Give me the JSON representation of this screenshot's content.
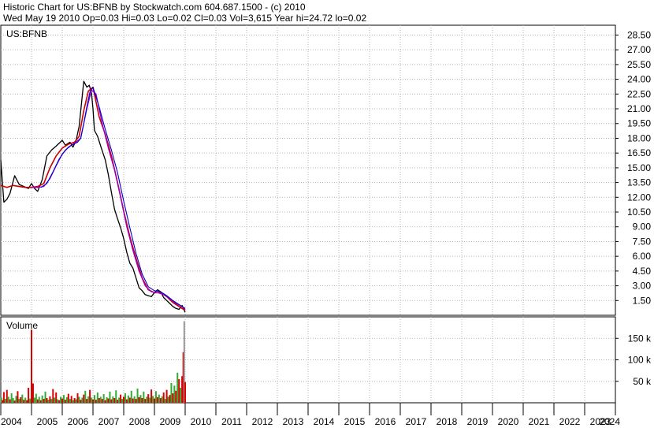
{
  "header": {
    "line1": "Historic Chart for US:BFNB by Stockwatch.com 604.687.1500 - (c) 2010",
    "line2": "Wed May 19 2010   Op=0.03  Hi=0.03  Lo=0.02  Cl=0.03  Vol=3,615  Year hi=24.72  lo=0.02"
  },
  "price_panel": {
    "symbol_label": "US:BFNB"
  },
  "volume_panel": {
    "label": "Volume"
  },
  "colors": {
    "up_volume": "#33aa33",
    "down_volume": "#dd0000",
    "spike_volume": "#999999",
    "ma_short": "#cc0000",
    "ma_mid": "#9900cc",
    "ma_long": "#0000cc",
    "price_bar": "#000000",
    "grid": "#b4b4b4"
  },
  "chart_data": [
    {
      "type": "line",
      "panel": "price",
      "ylim": [
        0,
        29.5
      ],
      "y_ticks": [
        1.5,
        3.0,
        4.5,
        6.0,
        7.5,
        9.0,
        10.5,
        12.0,
        13.5,
        15.0,
        16.5,
        18.0,
        19.5,
        21.0,
        22.5,
        24.0,
        25.5,
        27.0,
        28.5
      ],
      "y_tick_labels": [
        "1.50",
        "3.00",
        "4.50",
        "6.00",
        "7.50",
        "9.00",
        "10.50",
        "12.00",
        "13.50",
        "15.00",
        "16.50",
        "18.00",
        "19.50",
        "21.00",
        "22.50",
        "24.00",
        "25.50",
        "27.00",
        "28.50"
      ],
      "x_ticks": [
        "2004",
        "2005",
        "2006",
        "2007",
        "2008",
        "2009",
        "2010",
        "2011",
        "2012",
        "2013",
        "2014",
        "2015",
        "2016",
        "2017",
        "2018",
        "2019",
        "2020",
        "2021",
        "2022",
        "2023",
        "2024"
      ],
      "grid": true,
      "series": [
        {
          "x": [
            2004.0,
            2004.1,
            2004.2,
            2004.3,
            2004.45,
            2004.6,
            2004.75,
            2004.9,
            2005.0,
            2005.1,
            2005.2,
            2005.35,
            2005.5,
            2005.65,
            2005.8,
            2006.0,
            2006.1,
            2006.25,
            2006.35,
            2006.45,
            2006.55,
            2006.7,
            2006.8,
            2006.88,
            2006.95,
            2007.0,
            2007.05,
            2007.15,
            2007.25,
            2007.4,
            2007.5,
            2007.6,
            2007.7,
            2007.8,
            2007.9,
            2008.0,
            2008.1,
            2008.2,
            2008.3,
            2008.4,
            2008.5,
            2008.6,
            2008.7,
            2008.8,
            2008.9,
            2009.0,
            2009.1,
            2009.2,
            2009.3,
            2009.4,
            2009.5,
            2009.6,
            2009.7,
            2009.8,
            2009.9,
            2010.0
          ],
          "values": [
            15.8,
            11.5,
            11.8,
            12.4,
            14.2,
            13.3,
            13.1,
            12.9,
            13.4,
            12.9,
            12.6,
            13.8,
            16.2,
            16.8,
            17.2,
            17.8,
            17.3,
            17.6,
            17.1,
            17.8,
            19.2,
            23.8,
            23.2,
            23.4,
            22.6,
            21.0,
            18.8,
            18.2,
            17.2,
            15.8,
            14.3,
            12.5,
            10.8,
            9.8,
            8.9,
            7.8,
            6.4,
            5.3,
            4.8,
            3.8,
            2.8,
            2.5,
            2.1,
            2.0,
            1.9,
            2.3,
            2.6,
            2.4,
            1.8,
            1.5,
            1.2,
            0.9,
            0.7,
            0.6,
            1.0,
            0.3
          ]
        },
        {
          "x": [
            2004.0,
            2004.2,
            2004.4,
            2004.6,
            2004.8,
            2005.0,
            2005.2,
            2005.4,
            2005.6,
            2005.8,
            2006.0,
            2006.2,
            2006.4,
            2006.55,
            2006.7,
            2006.85,
            2007.0,
            2007.2,
            2007.4,
            2007.6,
            2007.8,
            2008.0,
            2008.2,
            2008.4,
            2008.6,
            2008.8,
            2009.0,
            2009.2,
            2009.4,
            2009.6,
            2009.8,
            2010.0
          ],
          "values": [
            13.2,
            13.0,
            13.2,
            13.1,
            13.0,
            13.0,
            13.1,
            13.4,
            15.0,
            16.2,
            17.0,
            17.4,
            17.6,
            18.2,
            20.8,
            22.8,
            23.2,
            20.2,
            18.4,
            16.2,
            13.5,
            10.6,
            8.0,
            5.8,
            3.8,
            2.6,
            2.3,
            2.3,
            1.9,
            1.3,
            0.9,
            0.5
          ]
        },
        {
          "x": [
            2005.0,
            2005.2,
            2005.4,
            2005.6,
            2005.8,
            2006.0,
            2006.2,
            2006.4,
            2006.6,
            2006.8,
            2006.95,
            2007.1,
            2007.3,
            2007.5,
            2007.7,
            2007.9,
            2008.1,
            2008.3,
            2008.5,
            2008.7,
            2008.9,
            2009.1,
            2009.3,
            2009.5,
            2009.7,
            2009.9,
            2010.0
          ],
          "values": [
            13.0,
            13.0,
            13.1,
            13.9,
            15.2,
            16.4,
            17.1,
            17.5,
            18.0,
            21.0,
            22.9,
            22.5,
            19.5,
            17.0,
            14.8,
            12.0,
            9.0,
            6.6,
            4.5,
            3.0,
            2.4,
            2.3,
            2.1,
            1.7,
            1.2,
            0.9,
            0.6
          ]
        },
        {
          "x": [
            2005.3,
            2005.5,
            2005.7,
            2005.9,
            2006.1,
            2006.3,
            2006.5,
            2006.6,
            2006.7,
            2006.8,
            2006.9,
            2007.0,
            2007.2,
            2007.4,
            2007.6,
            2007.8,
            2008.0,
            2008.2,
            2008.4,
            2008.6,
            2008.8,
            2009.0,
            2009.2,
            2009.4,
            2009.6,
            2009.8,
            2010.0
          ],
          "values": [
            13.0,
            13.4,
            14.6,
            15.9,
            16.8,
            17.3,
            17.6,
            18.0,
            19.5,
            21.2,
            22.7,
            23.2,
            21.2,
            18.9,
            16.8,
            14.5,
            11.6,
            8.9,
            6.3,
            4.2,
            2.9,
            2.5,
            2.4,
            2.0,
            1.5,
            1.1,
            0.7
          ]
        }
      ]
    },
    {
      "type": "bar",
      "panel": "volume",
      "ylim": [
        0,
        200000
      ],
      "y_ticks": [
        50000,
        100000,
        150000
      ],
      "y_tick_labels": [
        "50 k",
        "100 k",
        "150 k"
      ],
      "x": [
        2004.02,
        2004.06,
        2004.1,
        2004.15,
        2004.2,
        2004.25,
        2004.3,
        2004.35,
        2004.4,
        2004.45,
        2004.5,
        2004.55,
        2004.6,
        2004.65,
        2004.7,
        2004.75,
        2004.8,
        2004.85,
        2004.9,
        2004.95,
        2005.0,
        2005.05,
        2005.1,
        2005.15,
        2005.2,
        2005.25,
        2005.3,
        2005.35,
        2005.4,
        2005.45,
        2005.5,
        2005.55,
        2005.6,
        2005.65,
        2005.7,
        2005.75,
        2005.8,
        2005.85,
        2005.9,
        2005.95,
        2006.0,
        2006.05,
        2006.1,
        2006.15,
        2006.2,
        2006.25,
        2006.3,
        2006.35,
        2006.4,
        2006.45,
        2006.5,
        2006.55,
        2006.6,
        2006.65,
        2006.7,
        2006.75,
        2006.8,
        2006.85,
        2006.9,
        2006.95,
        2007.0,
        2007.05,
        2007.1,
        2007.15,
        2007.2,
        2007.25,
        2007.3,
        2007.35,
        2007.4,
        2007.45,
        2007.5,
        2007.55,
        2007.6,
        2007.65,
        2007.7,
        2007.75,
        2007.8,
        2007.85,
        2007.9,
        2007.95,
        2008.0,
        2008.05,
        2008.1,
        2008.15,
        2008.2,
        2008.25,
        2008.3,
        2008.35,
        2008.4,
        2008.45,
        2008.5,
        2008.55,
        2008.6,
        2008.65,
        2008.7,
        2008.75,
        2008.8,
        2008.85,
        2008.9,
        2008.95,
        2009.0,
        2009.05,
        2009.1,
        2009.15,
        2009.2,
        2009.25,
        2009.3,
        2009.35,
        2009.4,
        2009.45,
        2009.5,
        2009.55,
        2009.6,
        2009.65,
        2009.7,
        2009.75,
        2009.8,
        2009.85,
        2009.9,
        2009.94,
        2009.97,
        2010.0
      ],
      "values": [
        12000,
        6000,
        25000,
        9000,
        30000,
        14000,
        8000,
        22000,
        11000,
        5000,
        16000,
        27000,
        9000,
        13000,
        19000,
        7000,
        12000,
        6000,
        35000,
        10000,
        170000,
        45000,
        12000,
        21000,
        8000,
        14000,
        6000,
        17000,
        9000,
        26000,
        11000,
        7000,
        15000,
        9000,
        32000,
        12000,
        24000,
        8000,
        6000,
        14000,
        10000,
        18000,
        7000,
        13000,
        21000,
        9000,
        16000,
        6000,
        11000,
        8000,
        22000,
        14000,
        7000,
        12000,
        19000,
        28000,
        9000,
        15000,
        30000,
        12000,
        8000,
        18000,
        7000,
        24000,
        11000,
        14000,
        9000,
        20000,
        6000,
        13000,
        10000,
        26000,
        8000,
        15000,
        11000,
        29000,
        7000,
        12000,
        19000,
        9000,
        14000,
        22000,
        8000,
        17000,
        12000,
        28000,
        10000,
        15000,
        9000,
        33000,
        13000,
        18000,
        11000,
        26000,
        9000,
        14000,
        20000,
        12000,
        31000,
        16000,
        10000,
        27000,
        13000,
        19000,
        11000,
        15000,
        24000,
        9000,
        30000,
        14000,
        18000,
        46000,
        22000,
        40000,
        28000,
        70000,
        55000,
        35000,
        62000,
        118000,
        190000,
        48000
      ],
      "directions": [
        "up",
        "down",
        "down",
        "up",
        "down",
        "up",
        "down",
        "up",
        "up",
        "down",
        "up",
        "down",
        "up",
        "down",
        "up",
        "down",
        "up",
        "down",
        "down",
        "up",
        "down",
        "down",
        "up",
        "up",
        "down",
        "up",
        "down",
        "up",
        "down",
        "up",
        "down",
        "up",
        "down",
        "up",
        "down",
        "up",
        "down",
        "up",
        "down",
        "up",
        "down",
        "up",
        "down",
        "up",
        "down",
        "up",
        "down",
        "up",
        "down",
        "up",
        "down",
        "up",
        "down",
        "up",
        "down",
        "up",
        "down",
        "up",
        "down",
        "up",
        "down",
        "up",
        "down",
        "up",
        "down",
        "up",
        "down",
        "up",
        "down",
        "up",
        "down",
        "up",
        "down",
        "up",
        "down",
        "up",
        "down",
        "up",
        "down",
        "up",
        "down",
        "up",
        "down",
        "up",
        "down",
        "up",
        "down",
        "up",
        "down",
        "up",
        "down",
        "up",
        "down",
        "up",
        "down",
        "up",
        "down",
        "up",
        "down",
        "up",
        "down",
        "up",
        "down",
        "up",
        "down",
        "up",
        "down",
        "up",
        "down",
        "up",
        "down",
        "up",
        "down",
        "up",
        "down",
        "up",
        "down",
        "up",
        "down",
        "down",
        "spike",
        "down"
      ]
    }
  ]
}
